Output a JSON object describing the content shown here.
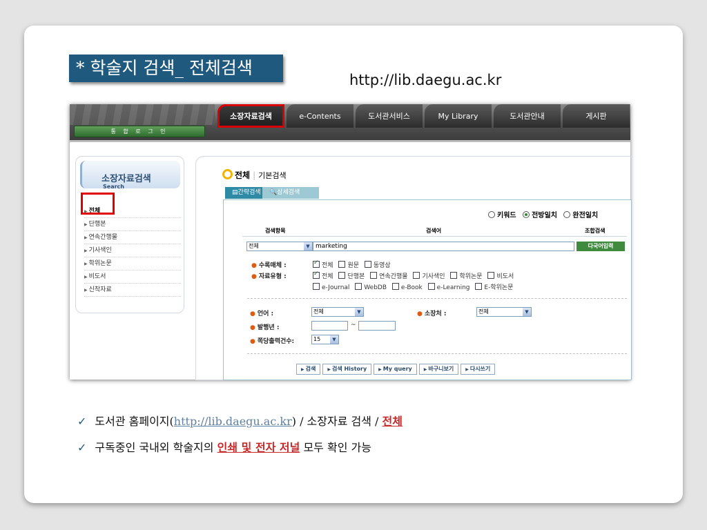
{
  "slide": {
    "title": "* 학술지 검색_ 전체검색",
    "url": "http://lib.daegu.ac.kr"
  },
  "site": {
    "login_label": "통 합 로 그 인",
    "nav": [
      {
        "label": "소장자료검색",
        "active": true
      },
      {
        "label": "e-Contents",
        "active": false
      },
      {
        "label": "도서관서비스",
        "active": false
      },
      {
        "label": "My Library",
        "active": false
      },
      {
        "label": "도서관안내",
        "active": false
      },
      {
        "label": "게시판",
        "active": false
      }
    ],
    "sidebar": {
      "title": "소장자료검색",
      "subtitle": "Search",
      "items": [
        "전체",
        "단행본",
        "연속간행물",
        "기사색인",
        "학위논문",
        "비도서",
        "신착자료"
      ]
    },
    "breadcrumb": {
      "current": "전체",
      "sub": "기본검색"
    },
    "subtabs": [
      "간략검색",
      "상세검색"
    ],
    "match_options": [
      {
        "label": "키워드",
        "selected": false
      },
      {
        "label": "전방일치",
        "selected": true
      },
      {
        "label": "완전일치",
        "selected": false
      }
    ],
    "headers": {
      "field": "검색항목",
      "term": "검색어",
      "combo": "조합검색"
    },
    "search": {
      "field_value": "전체",
      "term_value": "marketing",
      "multi_button": "다국어입력"
    },
    "filters": {
      "media_label": "수록매체 :",
      "media_options": [
        {
          "label": "전체",
          "checked": true
        },
        {
          "label": "원문",
          "checked": false
        },
        {
          "label": "동영상",
          "checked": false
        }
      ],
      "type_label": "자료유형 :",
      "type_options_row1": [
        {
          "label": "전체",
          "checked": true
        },
        {
          "label": "단행본",
          "checked": false
        },
        {
          "label": "연속간행물",
          "checked": false
        },
        {
          "label": "기사색인",
          "checked": false
        },
        {
          "label": "학위논문",
          "checked": false
        },
        {
          "label": "비도서",
          "checked": false
        }
      ],
      "type_options_row2": [
        {
          "label": "e-Journal",
          "checked": false
        },
        {
          "label": "WebDB",
          "checked": false
        },
        {
          "label": "e-Book",
          "checked": false
        },
        {
          "label": "e-Learning",
          "checked": false
        },
        {
          "label": "E-학위논문",
          "checked": false
        }
      ]
    },
    "options": {
      "language_label": "언어 :",
      "language_value": "전체",
      "location_label": "소장처 :",
      "location_value": "전체",
      "year_label": "발행년 :",
      "year_sep": "~",
      "perpage_label": "쪽당출력건수:",
      "perpage_value": "15"
    },
    "actions": [
      "검색",
      "검색 History",
      "My query",
      "바구니보기",
      "다시쓰기"
    ]
  },
  "bullets": {
    "b1_prefix": "도서관 홈페이지(",
    "b1_link": "http://lib.daegu.ac.kr",
    "b1_mid": ") / 소장자료 검색 / ",
    "b1_em": "전체",
    "b2_prefix": "구독중인 국내외 학술지의 ",
    "b2_em": "인쇄 및 전자 저널",
    "b2_suffix": " 모두 확인 가능"
  }
}
